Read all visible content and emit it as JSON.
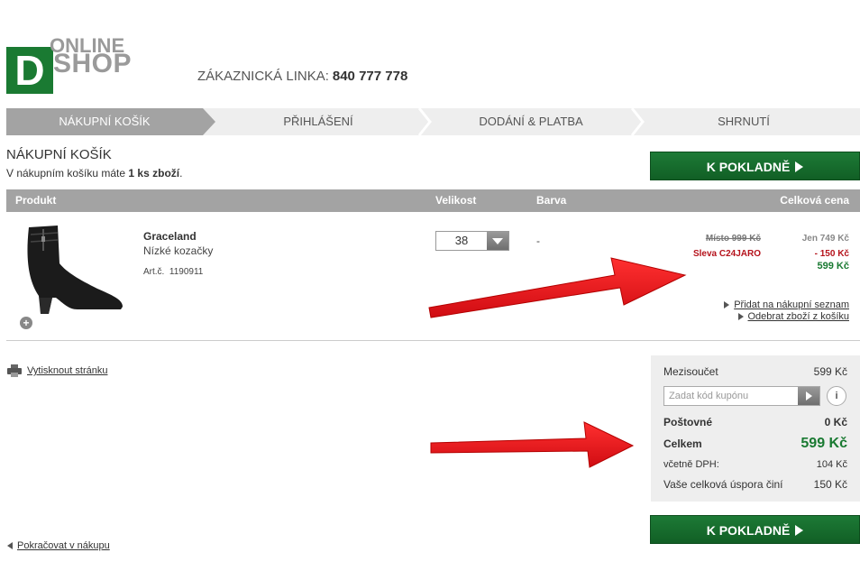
{
  "logo": {
    "letter": "D",
    "online": "ONLINE",
    "shop": "SHOP"
  },
  "hotline": {
    "label": "ZÁKAZNICKÁ LINKA:",
    "number": "840 777 778"
  },
  "steps": [
    {
      "label": "NÁKUPNÍ KOŠÍK",
      "active": true
    },
    {
      "label": "PŘIHLÁŠENÍ",
      "active": false
    },
    {
      "label": "DODÁNÍ & PLATBA",
      "active": false
    },
    {
      "label": "SHRNUTÍ",
      "active": false
    }
  ],
  "cart": {
    "title": "NÁKUPNÍ KOŠÍK",
    "info_prefix": "V nákupním košíku máte",
    "info_count": "1 ks zboží",
    "info_suffix": "."
  },
  "checkout_label": "K POKLADNĚ",
  "table": {
    "headers": {
      "product": "Produkt",
      "size": "Velikost",
      "color": "Barva",
      "total": "Celková cena"
    }
  },
  "product": {
    "name": "Graceland",
    "description": "Nízké kozačky",
    "art_label": "Art.č.",
    "art_number": "1190911",
    "size": "38",
    "color": "-",
    "price_original_label": "Místo 999 Kč",
    "price_now_label": "Jen 749 Kč",
    "discount_label": "Sleva C24JARO",
    "discount_value": "- 150 Kč",
    "final_price": "599 Kč",
    "add_to_list": "Přidat na nákupní seznam",
    "remove": "Odebrat zboží z košíku"
  },
  "print_label": "Vytisknout stránku",
  "summary": {
    "subtotal_label": "Mezisoučet",
    "subtotal_value": "599 Kč",
    "coupon_placeholder": "Zadat kód kupónu",
    "info_icon": "i",
    "shipping_label": "Poštovné",
    "shipping_value": "0 Kč",
    "total_label": "Celkem",
    "total_value": "599 Kč",
    "vat_label": "včetně DPH:",
    "vat_value": "104 Kč",
    "savings_label": "Vaše celková úspora činí",
    "savings_value": "150 Kč"
  },
  "continue_label": "Pokračovat v nákupu",
  "colors": {
    "brand_green": "#1a7a32",
    "discount_red": "#b5121b",
    "annotation_red": "#e8141b",
    "step_active": "#a3a3a3"
  },
  "icons": [
    "printer-icon",
    "zoom-plus-icon",
    "dropdown-arrow-icon",
    "coupon-submit-icon",
    "info-icon"
  ]
}
